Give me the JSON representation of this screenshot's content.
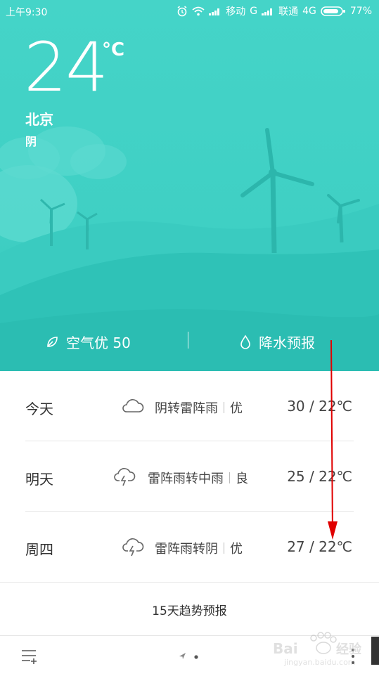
{
  "status_bar": {
    "time": "上午9:30",
    "carrier1": "移动",
    "network1": "G",
    "carrier2": "联通",
    "network2": "4G",
    "battery": "77%"
  },
  "current": {
    "temperature": "24",
    "unit": "°C",
    "city": "北京",
    "condition": "阴"
  },
  "info": {
    "air_quality": "空气优 50",
    "rain_forecast": "降水预报"
  },
  "forecast": [
    {
      "day": "今天",
      "weather": "阴转雷阵雨",
      "air": "优",
      "range": "30 / 22℃",
      "icon": "cloud-icon"
    },
    {
      "day": "明天",
      "weather": "雷阵雨转中雨",
      "air": "良",
      "range": "25 / 22℃",
      "icon": "thunderstorm-icon"
    },
    {
      "day": "周四",
      "weather": "雷阵雨转阴",
      "air": "优",
      "range": "27 / 22℃",
      "icon": "thunderstorm-icon"
    }
  ],
  "trend_label": "15天趋势预报",
  "watermark": {
    "brand": "Baidu经验",
    "url": "jingyan.baidu.com"
  },
  "colors": {
    "sky": "#45d4c8",
    "hill": "#2ec0b5",
    "annotation_arrow": "#e00000"
  }
}
